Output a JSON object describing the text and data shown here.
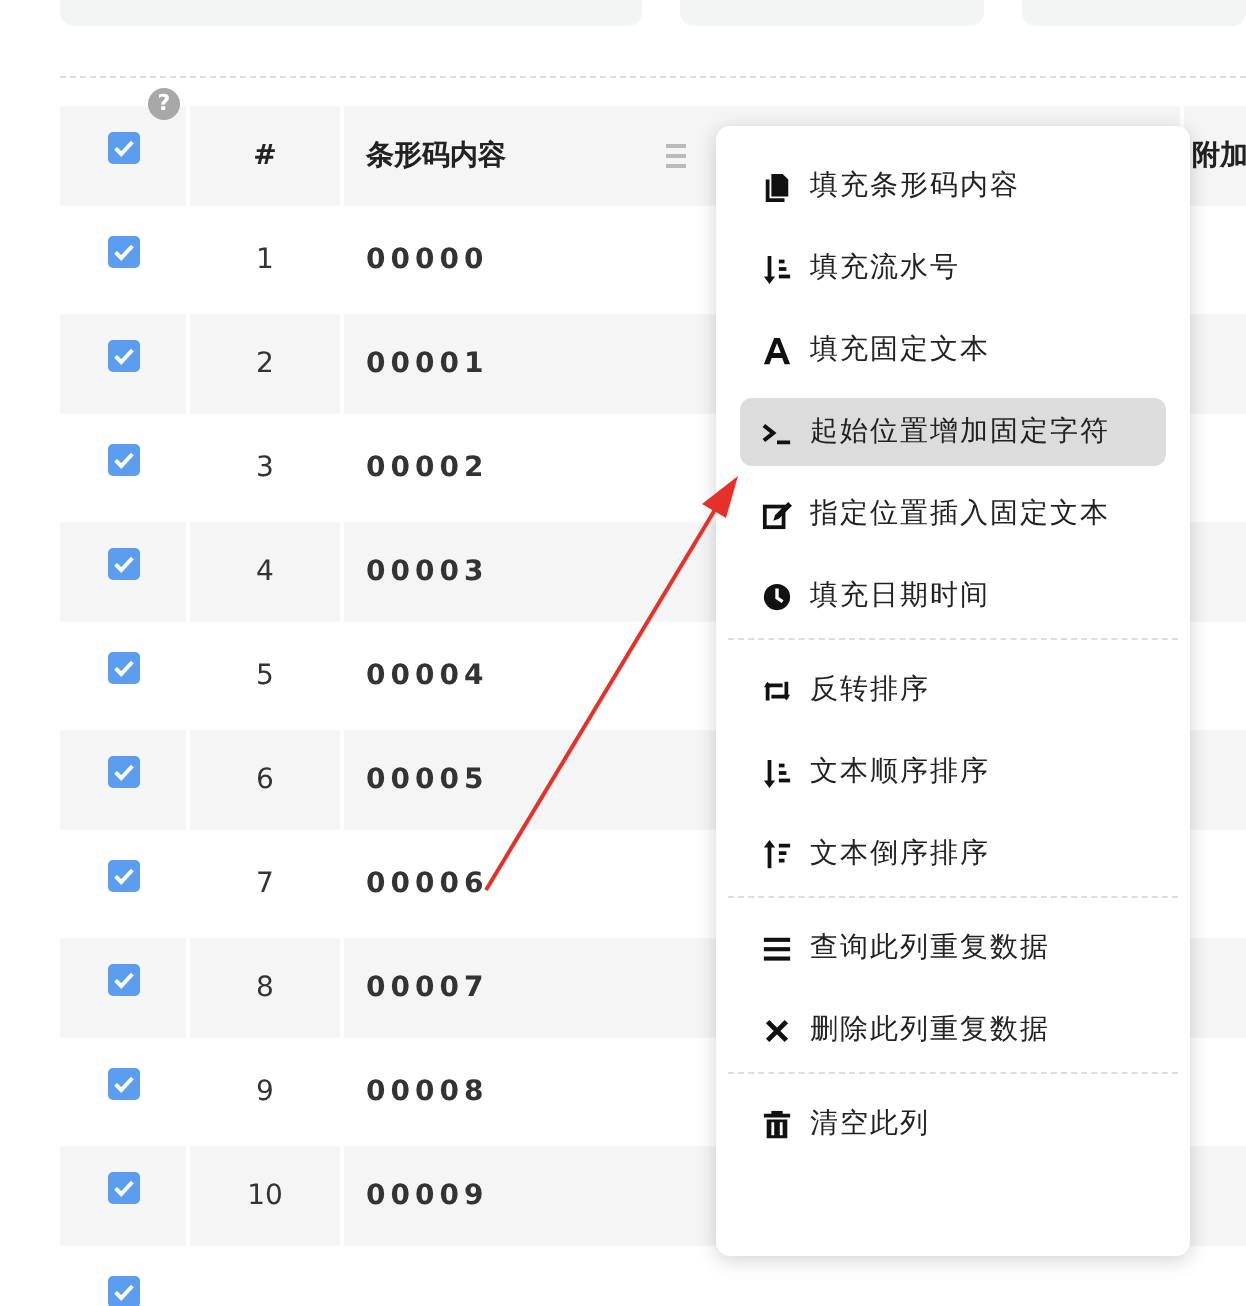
{
  "table": {
    "columns": [
      {
        "kind": "check",
        "checked": true,
        "help": "?"
      },
      {
        "label": "#",
        "kind": "index"
      },
      {
        "label": "条形码内容",
        "kind": "content"
      },
      {
        "label": "附加",
        "kind": "extra"
      }
    ],
    "rows": [
      {
        "checked": true,
        "index": "1",
        "code": "00000"
      },
      {
        "checked": true,
        "index": "2",
        "code": "00001"
      },
      {
        "checked": true,
        "index": "3",
        "code": "00002"
      },
      {
        "checked": true,
        "index": "4",
        "code": "00003"
      },
      {
        "checked": true,
        "index": "5",
        "code": "00004"
      },
      {
        "checked": true,
        "index": "6",
        "code": "00005"
      },
      {
        "checked": true,
        "index": "7",
        "code": "00006"
      },
      {
        "checked": true,
        "index": "8",
        "code": "00007"
      },
      {
        "checked": true,
        "index": "9",
        "code": "00008"
      },
      {
        "checked": true,
        "index": "10",
        "code": "00009"
      },
      {
        "checked": true
      }
    ]
  },
  "context_menu": {
    "groups": [
      [
        {
          "label": "填充条形码内容",
          "selected": false
        },
        {
          "label": "填充流水号",
          "selected": false
        },
        {
          "label": "填充固定文本",
          "selected": false
        },
        {
          "label": "起始位置增加固定字符",
          "selected": true
        },
        {
          "label": "指定位置插入固定文本",
          "selected": false
        },
        {
          "label": "填充日期时间",
          "selected": false
        }
      ],
      [
        {
          "label": "反转排序",
          "selected": false
        },
        {
          "label": "文本顺序排序",
          "selected": false
        },
        {
          "label": "文本倒序排序",
          "selected": false
        }
      ],
      [
        {
          "label": "查询此列重复数据",
          "selected": false
        },
        {
          "label": "删除此列重复数据",
          "selected": false
        }
      ],
      [
        {
          "label": "清空此列",
          "selected": false
        }
      ]
    ]
  }
}
